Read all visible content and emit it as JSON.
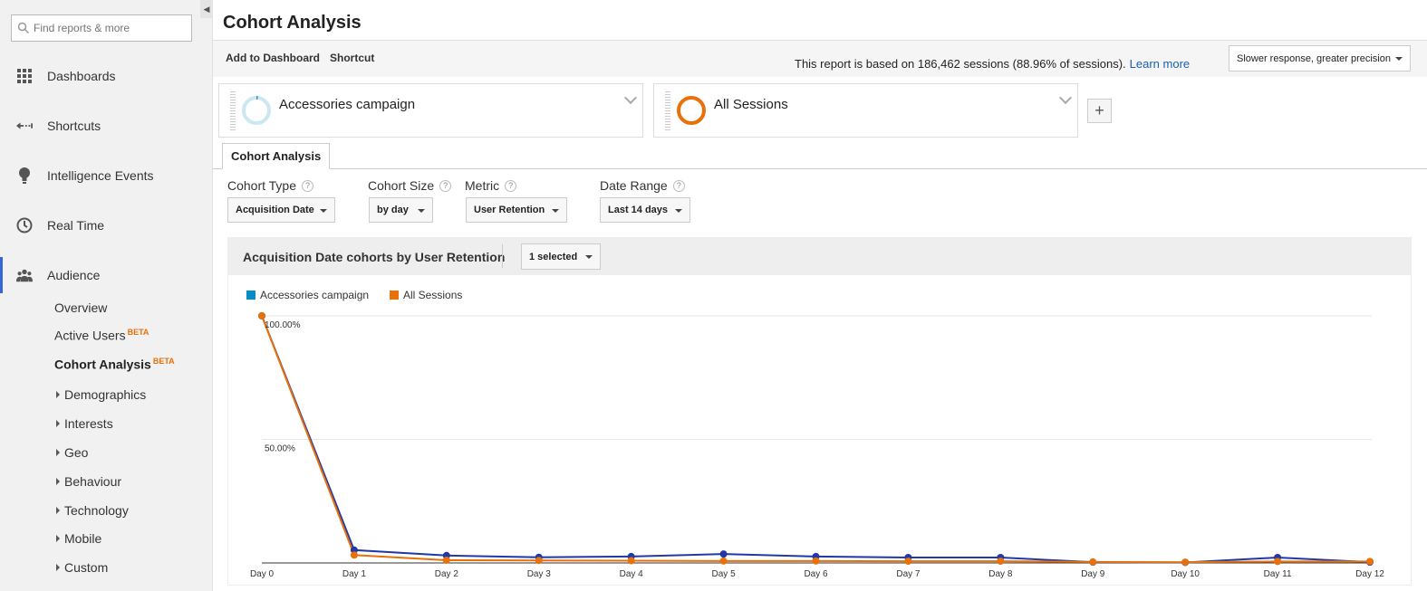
{
  "search": {
    "placeholder": "Find reports & more"
  },
  "sidebar": {
    "main_items": [
      {
        "label": "Dashboards",
        "icon": "dashboards-icon"
      },
      {
        "label": "Shortcuts",
        "icon": "shortcuts-icon"
      },
      {
        "label": "Intelligence Events",
        "icon": "lightbulb-icon"
      },
      {
        "label": "Real Time",
        "icon": "clock-icon"
      },
      {
        "label": "Audience",
        "icon": "audience-icon",
        "active": true
      }
    ],
    "audience_items": [
      {
        "label": "Overview"
      },
      {
        "label": "Active Users",
        "badge": "BETA"
      },
      {
        "label": "Cohort Analysis",
        "badge": "BETA",
        "selected": true
      }
    ],
    "audience_groups": [
      "Demographics",
      "Interests",
      "Geo",
      "Behaviour",
      "Technology",
      "Mobile",
      "Custom"
    ]
  },
  "header": {
    "title": "Cohort Analysis",
    "add_to_dashboard": "Add to Dashboard",
    "shortcut": "Shortcut",
    "sampling_text": "This report is based on 186,462 sessions (88.96% of sessions).",
    "learn_more": "Learn more",
    "precision": "Slower response, greater precision"
  },
  "segments": [
    {
      "name": "Accessories campaign",
      "color": "#cde7f2",
      "accent": "#4a90c2"
    },
    {
      "name": "All Sessions",
      "color": "#e8710a"
    }
  ],
  "tabs": {
    "cohort": "Cohort Analysis"
  },
  "controls": {
    "cohort_type": {
      "label": "Cohort Type",
      "value": "Acquisition Date"
    },
    "cohort_size": {
      "label": "Cohort Size",
      "value": "by day"
    },
    "metric": {
      "label": "Metric",
      "value": "User Retention"
    },
    "date_range": {
      "label": "Date Range",
      "value": "Last 14 days"
    }
  },
  "chart_panel": {
    "title": "Acquisition Date cohorts by User Retention",
    "selected": "1 selected"
  },
  "chart_data": {
    "type": "line",
    "categories": [
      "Day 0",
      "Day 1",
      "Day 2",
      "Day 3",
      "Day 4",
      "Day 5",
      "Day 6",
      "Day 7",
      "Day 8",
      "Day 9",
      "Day 10",
      "Day 11",
      "Day 12"
    ],
    "y_ticks": [
      "100.00%",
      "50.00%"
    ],
    "ylim": [
      0,
      100
    ],
    "series": [
      {
        "name": "Accessories campaign",
        "color": "#2138a8",
        "legend_color": "#058dc7",
        "values": [
          100,
          5.2,
          3.0,
          2.3,
          2.6,
          3.6,
          2.6,
          2.2,
          2.2,
          0.3,
          0.2,
          2.2,
          0.3
        ]
      },
      {
        "name": "All Sessions",
        "color": "#e8710a",
        "legend_color": "#e8710a",
        "values": [
          100,
          3.2,
          1.1,
          1.0,
          0.9,
          0.8,
          0.8,
          0.7,
          0.7,
          0.4,
          0.3,
          0.6,
          0.6
        ]
      }
    ]
  }
}
